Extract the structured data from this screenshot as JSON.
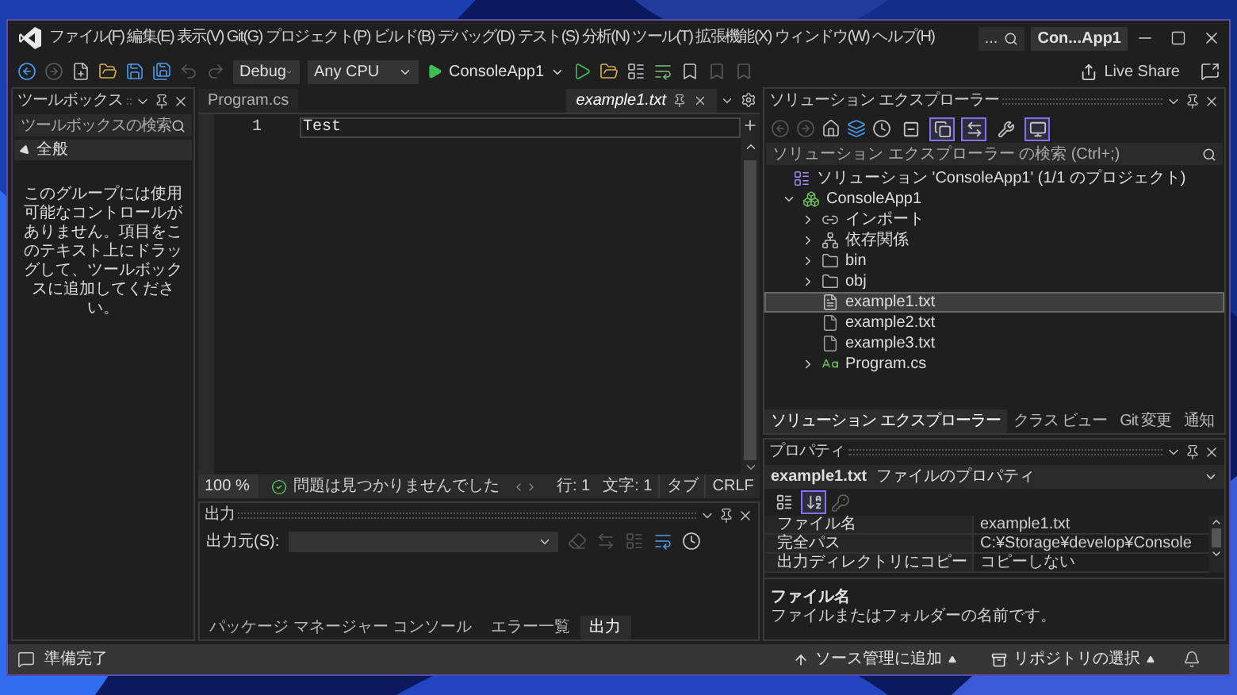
{
  "title_bar": {
    "menu": [
      "ファイル(F)",
      "編集(E)",
      "表示(V)",
      "Git(G)",
      "プロジェクト(P)",
      "ビルド(B)",
      "デバッグ(D)",
      "テスト(S)",
      "分析(N)",
      "ツール(T)",
      "拡張機能(X)",
      "ウィンドウ(W)",
      "ヘルプ(H)"
    ],
    "search_button": "...",
    "solution_name": "Con...App1"
  },
  "toolbar": {
    "configuration": "Debug",
    "platform": "Any CPU",
    "start_target": "ConsoleApp1",
    "live_share": "Live Share"
  },
  "toolbox": {
    "title": "ツールボックス",
    "search_placeholder": "ツールボックスの検索",
    "group": {
      "label": "全般",
      "expanded": true
    },
    "empty_message": "このグループには使用可能なコントロールがありません。項目をこのテキスト上にドラッグして、ツールボックスに追加してください。"
  },
  "editor": {
    "tabs": [
      {
        "label": "Program.cs",
        "kind": "document",
        "selected": false
      },
      {
        "label": "example1.txt",
        "kind": "preview",
        "selected": true
      }
    ],
    "lines": [
      {
        "number": "1",
        "text": "Test"
      }
    ],
    "zoom": "100 %",
    "issues": "問題は見つかりませんでした",
    "line": "行: 1",
    "column": "文字: 1",
    "indent": "タブ",
    "line_ending": "CRLF"
  },
  "output": {
    "title": "出力",
    "source_label": "出力元(S):"
  },
  "bottom_tabs": [
    {
      "label": "パッケージ マネージャー コンソール",
      "selected": false
    },
    {
      "label": "エラー一覧",
      "selected": false
    },
    {
      "label": "出力",
      "selected": true
    }
  ],
  "solution_explorer": {
    "title": "ソリューション エクスプローラー",
    "toggles": [
      {
        "kind": "collapse",
        "on": false
      },
      {
        "kind": "show_all",
        "on": true
      },
      {
        "kind": "sync",
        "on": true
      },
      {
        "kind": "properties",
        "on": false
      },
      {
        "kind": "preview",
        "on": true
      }
    ],
    "search_placeholder": "ソリューション エクスプローラー の検索 (Ctrl+;)",
    "tree": [
      {
        "label": "ソリューション 'ConsoleApp1' (1/1 のプロジェクト)",
        "kind": "solution",
        "selected": false,
        "children": [
          {
            "label": "ConsoleApp1",
            "kind": "project",
            "expanded": true,
            "selected": false,
            "children": [
              {
                "label": "インポート",
                "kind": "imports",
                "expanded": false,
                "selected": false
              },
              {
                "label": "依存関係",
                "kind": "dependencies",
                "expanded": false,
                "selected": false
              },
              {
                "label": "bin",
                "kind": "folder",
                "expanded": false,
                "selected": false
              },
              {
                "label": "obj",
                "kind": "folder",
                "expanded": false,
                "selected": false
              },
              {
                "label": "example1.txt",
                "kind": "text_file",
                "selected": true
              },
              {
                "label": "example2.txt",
                "kind": "file",
                "selected": false
              },
              {
                "label": "example3.txt",
                "kind": "file",
                "selected": false
              },
              {
                "label": "Program.cs",
                "kind": "csharp",
                "expanded": false,
                "selected": false
              }
            ]
          }
        ]
      }
    ],
    "tabs": [
      {
        "label": "ソリューション エクスプローラー",
        "selected": true
      },
      {
        "label": "クラス ビュー",
        "selected": false
      },
      {
        "label": "Git 変更",
        "selected": false
      },
      {
        "label": "通知",
        "selected": false
      }
    ]
  },
  "properties": {
    "title": "プロパティ",
    "object": "example1.txt",
    "object_type": "ファイルのプロパティ",
    "toggles": [
      {
        "kind": "categorized",
        "on": false
      },
      {
        "kind": "alphabetical",
        "on": true
      }
    ],
    "rows": [
      {
        "name": "ファイル名",
        "value": "example1.txt"
      },
      {
        "name": "完全パス",
        "value": "C:¥Storage¥develop¥Console"
      },
      {
        "name": "出力ディレクトリにコピー",
        "value": "コピーしない"
      }
    ],
    "description_title": "ファイル名",
    "description": "ファイルまたはフォルダーの名前です。"
  },
  "status_bar": {
    "message": "準備完了",
    "source_control": "ソース管理に追加",
    "repository": "リポジトリの選択"
  }
}
